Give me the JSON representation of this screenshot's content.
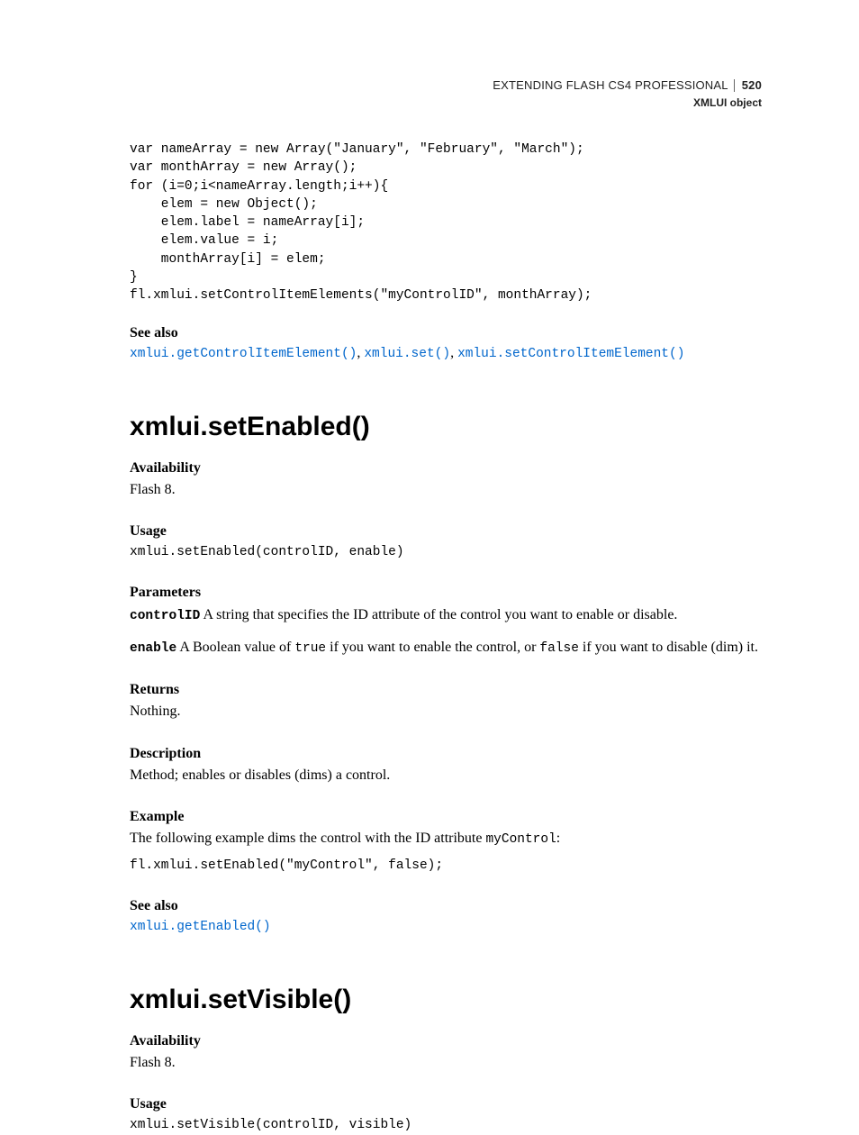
{
  "header": {
    "title": "EXTENDING FLASH CS4 PROFESSIONAL",
    "page": "520",
    "section": "XMLUI object"
  },
  "code1": "var nameArray = new Array(\"January\", \"February\", \"March\");\nvar monthArray = new Array();\nfor (i=0;i<nameArray.length;i++){\n    elem = new Object();\n    elem.label = nameArray[i];\n    elem.value = i;\n    monthArray[i] = elem;\n}\nfl.xmlui.setControlItemElements(\"myControlID\", monthArray);",
  "labels": {
    "see_also": "See also",
    "availability": "Availability",
    "usage": "Usage",
    "parameters": "Parameters",
    "returns": "Returns",
    "description": "Description",
    "example": "Example"
  },
  "see_also1": {
    "l1": "xmlui.getControlItemElement()",
    "l2": "xmlui.set()",
    "l3": "xmlui.setControlItemElement()"
  },
  "setEnabled": {
    "heading": "xmlui.setEnabled()",
    "availability": "Flash 8.",
    "usage": "xmlui.setEnabled(controlID, enable)",
    "param1_name": "controlID",
    "param1_desc": "  A string that specifies the ID attribute of the control you want to enable or disable.",
    "param2_name": "enable",
    "param2_pre": "  A Boolean value of ",
    "param2_true": "true",
    "param2_mid": " if you want to enable the control, or ",
    "param2_false": "false",
    "param2_post": " if you want to disable (dim) it.",
    "returns": "Nothing.",
    "description": "Method; enables or disables (dims) a control.",
    "example_intro_pre": "The following example dims the control with the ID attribute ",
    "example_intro_code": "myControl",
    "example_intro_post": ":",
    "example_code": "fl.xmlui.setEnabled(\"myControl\", false);",
    "see_also_link": "xmlui.getEnabled()"
  },
  "setVisible": {
    "heading": "xmlui.setVisible()",
    "availability": "Flash 8.",
    "usage": "xmlui.setVisible(controlID, visible)"
  }
}
